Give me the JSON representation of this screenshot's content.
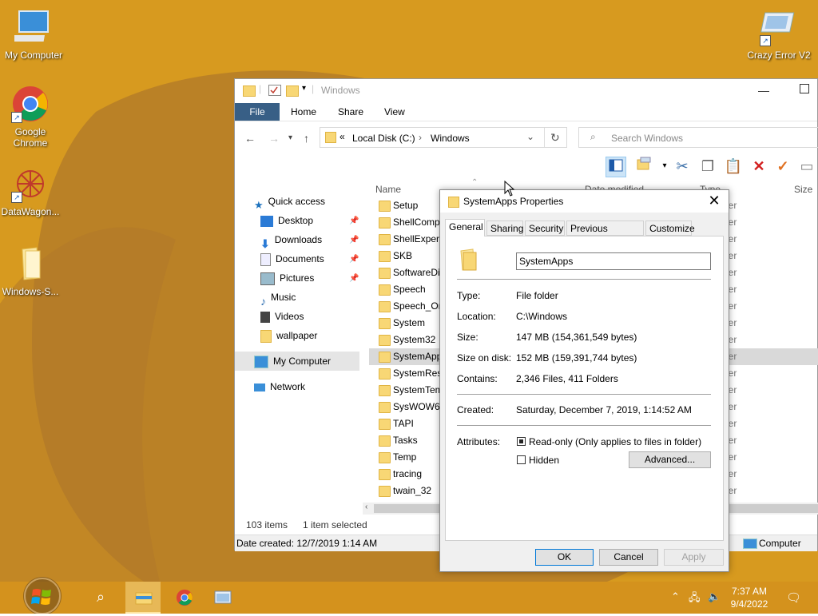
{
  "desktop": {
    "icons": [
      {
        "label": "My Computer"
      },
      {
        "label": "Google Chrome"
      },
      {
        "label": "DataWagon..."
      },
      {
        "label": "Windows-S..."
      },
      {
        "label": "Crazy Error V2"
      }
    ]
  },
  "explorer": {
    "title": "Windows",
    "ribbon_tabs": [
      "File",
      "Home",
      "Share",
      "View"
    ],
    "address": {
      "prefix": "«",
      "segments": [
        "Local Disk (C:)",
        "Windows"
      ]
    },
    "search_placeholder": "Search Windows",
    "columns": [
      "Name",
      "Date modified",
      "Type",
      "Size"
    ],
    "nav": {
      "quick_access": "Quick access",
      "items": [
        "Desktop",
        "Downloads",
        "Documents",
        "Pictures",
        "Music",
        "Videos",
        "wallpaper"
      ],
      "my_computer": "My Computer",
      "network": "Network"
    },
    "files": [
      {
        "name": "Setup",
        "type": "der"
      },
      {
        "name": "ShellComp",
        "type": "der"
      },
      {
        "name": "ShellExperie",
        "type": "der"
      },
      {
        "name": "SKB",
        "type": "der"
      },
      {
        "name": "SoftwareDis",
        "type": "der"
      },
      {
        "name": "Speech",
        "type": "der"
      },
      {
        "name": "Speech_On",
        "type": "der"
      },
      {
        "name": "System",
        "type": "der"
      },
      {
        "name": "System32",
        "type": "der"
      },
      {
        "name": "SystemApp",
        "type": "der"
      },
      {
        "name": "SystemReso",
        "type": "der"
      },
      {
        "name": "SystemTem",
        "type": "der"
      },
      {
        "name": "SysWOW64",
        "type": "der"
      },
      {
        "name": "TAPI",
        "type": "der"
      },
      {
        "name": "Tasks",
        "type": "der"
      },
      {
        "name": "Temp",
        "type": "der"
      },
      {
        "name": "tracing",
        "type": "der"
      },
      {
        "name": "twain_32",
        "type": "der"
      }
    ],
    "selected_index": 9,
    "status": {
      "count": "103 items",
      "selected": "1 item selected"
    },
    "details": {
      "created": "Date created: 12/7/2019 1:14 AM",
      "location": "Computer"
    }
  },
  "dialog": {
    "title": "SystemApps Properties",
    "tabs": [
      "General",
      "Sharing",
      "Security",
      "Previous Versions",
      "Customize"
    ],
    "name": "SystemApps",
    "type_label": "Type:",
    "type_value": "File folder",
    "location_label": "Location:",
    "location_value": "C:\\Windows",
    "size_label": "Size:",
    "size_value": "147 MB (154,361,549 bytes)",
    "size_disk_label": "Size on disk:",
    "size_disk_value": "152 MB (159,391,744 bytes)",
    "contains_label": "Contains:",
    "contains_value": "2,346 Files, 411 Folders",
    "created_label": "Created:",
    "created_value": "Saturday, December 7, 2019, 1:14:52 AM",
    "attributes_label": "Attributes:",
    "readonly_label": "Read-only (Only applies to files in folder)",
    "hidden_label": "Hidden",
    "advanced_label": "Advanced...",
    "ok_label": "OK",
    "cancel_label": "Cancel",
    "apply_label": "Apply"
  },
  "taskbar": {
    "time": "7:37 AM",
    "date": "9/4/2022"
  },
  "colors": {
    "desktop": "#d79a1f",
    "taskbar": "#d4921d",
    "accent": "#0078d7"
  }
}
